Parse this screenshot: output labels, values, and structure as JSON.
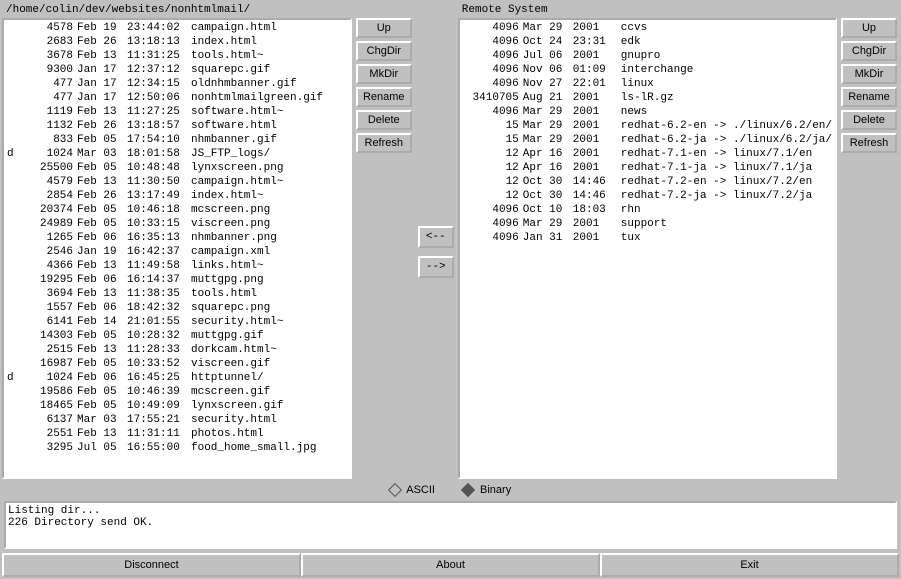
{
  "local": {
    "path": "/home/colin/dev/websites/nonhtmlmail/",
    "buttons": {
      "up": "Up",
      "chgdir": "ChgDir",
      "mkdir": "MkDir",
      "rename": "Rename",
      "delete": "Delete",
      "refresh": "Refresh"
    },
    "files": [
      {
        "flag": "",
        "size": "4578",
        "date": "Feb 19",
        "time": "23:44:02",
        "name": "campaign.html"
      },
      {
        "flag": "",
        "size": "2683",
        "date": "Feb 26",
        "time": "13:18:13",
        "name": "index.html"
      },
      {
        "flag": "",
        "size": "3678",
        "date": "Feb 13",
        "time": "11:31:25",
        "name": "tools.html~"
      },
      {
        "flag": "",
        "size": "9300",
        "date": "Jan 17",
        "time": "12:37:12",
        "name": "squarepc.gif"
      },
      {
        "flag": "",
        "size": "477",
        "date": "Jan 17",
        "time": "12:34:15",
        "name": "oldnhmbanner.gif"
      },
      {
        "flag": "",
        "size": "477",
        "date": "Jan 17",
        "time": "12:50:06",
        "name": "nonhtmlmailgreen.gif"
      },
      {
        "flag": "",
        "size": "1119",
        "date": "Feb 13",
        "time": "11:27:25",
        "name": "software.html~"
      },
      {
        "flag": "",
        "size": "1132",
        "date": "Feb 26",
        "time": "13:18:57",
        "name": "software.html"
      },
      {
        "flag": "",
        "size": "833",
        "date": "Feb 05",
        "time": "17:54:10",
        "name": "nhmbanner.gif"
      },
      {
        "flag": "d",
        "size": "1024",
        "date": "Mar 03",
        "time": "18:01:58",
        "name": "JS_FTP_logs/"
      },
      {
        "flag": "",
        "size": "25500",
        "date": "Feb 05",
        "time": "10:48:48",
        "name": "lynxscreen.png"
      },
      {
        "flag": "",
        "size": "4579",
        "date": "Feb 13",
        "time": "11:30:50",
        "name": "campaign.html~"
      },
      {
        "flag": "",
        "size": "2854",
        "date": "Feb 26",
        "time": "13:17:49",
        "name": "index.html~"
      },
      {
        "flag": "",
        "size": "20374",
        "date": "Feb 05",
        "time": "10:46:18",
        "name": "mcscreen.png"
      },
      {
        "flag": "",
        "size": "24989",
        "date": "Feb 05",
        "time": "10:33:15",
        "name": "viscreen.png"
      },
      {
        "flag": "",
        "size": "1265",
        "date": "Feb 06",
        "time": "16:35:13",
        "name": "nhmbanner.png"
      },
      {
        "flag": "",
        "size": "2546",
        "date": "Jan 19",
        "time": "16:42:37",
        "name": "campaign.xml"
      },
      {
        "flag": "",
        "size": "4366",
        "date": "Feb 13",
        "time": "11:49:58",
        "name": "links.html~"
      },
      {
        "flag": "",
        "size": "19295",
        "date": "Feb 06",
        "time": "16:14:37",
        "name": "muttgpg.png"
      },
      {
        "flag": "",
        "size": "3694",
        "date": "Feb 13",
        "time": "11:38:35",
        "name": "tools.html"
      },
      {
        "flag": "",
        "size": "1557",
        "date": "Feb 06",
        "time": "18:42:32",
        "name": "squarepc.png"
      },
      {
        "flag": "",
        "size": "6141",
        "date": "Feb 14",
        "time": "21:01:55",
        "name": "security.html~"
      },
      {
        "flag": "",
        "size": "14303",
        "date": "Feb 05",
        "time": "10:28:32",
        "name": "muttgpg.gif"
      },
      {
        "flag": "",
        "size": "2515",
        "date": "Feb 13",
        "time": "11:28:33",
        "name": "dorkcam.html~"
      },
      {
        "flag": "",
        "size": "16987",
        "date": "Feb 05",
        "time": "10:33:52",
        "name": "viscreen.gif"
      },
      {
        "flag": "d",
        "size": "1024",
        "date": "Feb 06",
        "time": "16:45:25",
        "name": "httptunnel/"
      },
      {
        "flag": "",
        "size": "19586",
        "date": "Feb 05",
        "time": "10:46:39",
        "name": "mcscreen.gif"
      },
      {
        "flag": "",
        "size": "18465",
        "date": "Feb 05",
        "time": "10:49:09",
        "name": "lynxscreen.gif"
      },
      {
        "flag": "",
        "size": "6137",
        "date": "Mar 03",
        "time": "17:55:21",
        "name": "security.html"
      },
      {
        "flag": "",
        "size": "2551",
        "date": "Feb 13",
        "time": "11:31:11",
        "name": "photos.html"
      },
      {
        "flag": "",
        "size": "3295",
        "date": "Jul 05",
        "time": "16:55:00",
        "name": "food_home_small.jpg"
      }
    ]
  },
  "remote": {
    "path": "Remote System",
    "buttons": {
      "up": "Up",
      "chgdir": "ChgDir",
      "mkdir": "MkDir",
      "rename": "Rename",
      "delete": "Delete",
      "refresh": "Refresh"
    },
    "files": [
      {
        "size": "4096",
        "date": "Mar 29",
        "time": "2001",
        "name": "ccvs"
      },
      {
        "size": "4096",
        "date": "Oct 24",
        "time": "23:31",
        "name": "edk"
      },
      {
        "size": "4096",
        "date": "Jul 06",
        "time": "2001",
        "name": "gnupro"
      },
      {
        "size": "4096",
        "date": "Nov 06",
        "time": "01:09",
        "name": "interchange"
      },
      {
        "size": "4096",
        "date": "Nov 27",
        "time": "22:01",
        "name": "linux"
      },
      {
        "size": "3410705",
        "date": "Aug 21",
        "time": "2001",
        "name": "ls-lR.gz"
      },
      {
        "size": "4096",
        "date": "Mar 29",
        "time": "2001",
        "name": "news"
      },
      {
        "size": "15",
        "date": "Mar 29",
        "time": "2001",
        "name": "redhat-6.2-en -> ./linux/6.2/en/"
      },
      {
        "size": "15",
        "date": "Mar 29",
        "time": "2001",
        "name": "redhat-6.2-ja -> ./linux/6.2/ja/"
      },
      {
        "size": "12",
        "date": "Apr 16",
        "time": "2001",
        "name": "redhat-7.1-en -> linux/7.1/en"
      },
      {
        "size": "12",
        "date": "Apr 16",
        "time": "2001",
        "name": "redhat-7.1-ja -> linux/7.1/ja"
      },
      {
        "size": "12",
        "date": "Oct 30",
        "time": "14:46",
        "name": "redhat-7.2-en -> linux/7.2/en"
      },
      {
        "size": "12",
        "date": "Oct 30",
        "time": "14:46",
        "name": "redhat-7.2-ja -> linux/7.2/ja"
      },
      {
        "size": "4096",
        "date": "Oct 10",
        "time": "18:03",
        "name": "rhn"
      },
      {
        "size": "4096",
        "date": "Mar 29",
        "time": "2001",
        "name": "support"
      },
      {
        "size": "4096",
        "date": "Jan 31",
        "time": "2001",
        "name": "tux"
      }
    ]
  },
  "transfer": {
    "left": "<--",
    "right": "-->"
  },
  "mode": {
    "ascii": "ASCII",
    "binary": "Binary",
    "selected": "binary"
  },
  "log": "Listing dir...\n226 Directory send OK.\n",
  "bottom": {
    "disconnect": "Disconnect",
    "about": "About",
    "exit": "Exit"
  }
}
